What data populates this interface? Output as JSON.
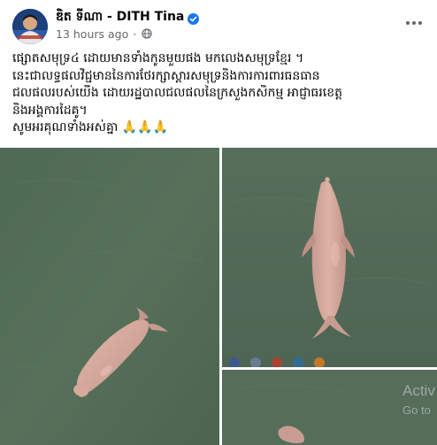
{
  "post": {
    "author": "ឌិត ទីណា - DITH Tina",
    "time": "13 hours ago",
    "separator": "·",
    "text_lines": [
      "ផ្សោតសមុទ្រ៤ ដោយមានទាំងកូនមួយផង មកលេងសមុទ្រខ្មែរ ។",
      "នេះជាលទ្ធផលវិជ្ជមាននៃការថែរក្សាស្តារសមុទ្រនិងការការពារធនធាន",
      "ជលផលរបស់យើង ដោយរដ្ឋបាលជលផលនៃក្រសួងកសិកម្ម អាជ្ញាធរខេត្ត",
      "និងអង្គការដៃគូ។",
      "សូមអរគុណទាំងអស់គ្នា 🙏🙏🙏"
    ]
  },
  "overlay": {
    "activate_title": "Activ",
    "activate_sub": "Go to"
  },
  "colors": {
    "verified": "#1877f2",
    "water": "#536b57",
    "dolphin": "#cf9f93",
    "meta": "#65676b"
  },
  "icons": {
    "verified": "verified-badge-icon",
    "privacy": "globe-icon",
    "more": "more-dots-icon"
  }
}
